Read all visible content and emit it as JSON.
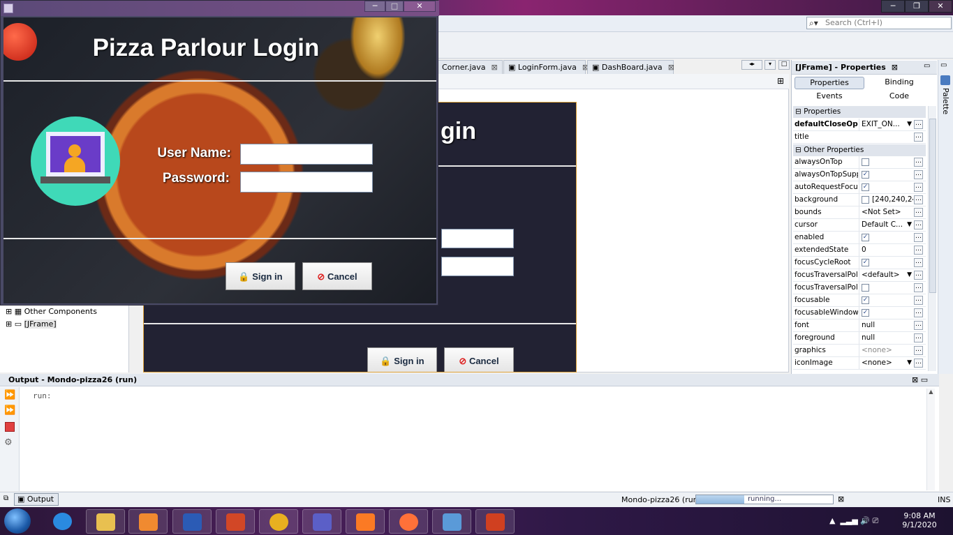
{
  "ide": {
    "search_placeholder": "Search (Ctrl+I)",
    "tabs": [
      {
        "label": "Corner.java"
      },
      {
        "label": "LoginForm.java"
      },
      {
        "label": "DashBoard.java"
      }
    ],
    "tree": [
      {
        "label": "Other Components"
      },
      {
        "label": "[JFrame]"
      }
    ]
  },
  "properties": {
    "title": "[JFrame] - Properties",
    "buttons": [
      "Properties",
      "Binding",
      "Events",
      "Code"
    ],
    "section_properties": "Properties",
    "section_other": "Other Properties",
    "rows": [
      {
        "name": "defaultCloseOpe",
        "value": "EXIT_ON...",
        "kind": "combo"
      },
      {
        "name": "title",
        "value": "",
        "kind": "text"
      }
    ],
    "other_rows": [
      {
        "name": "alwaysOnTop",
        "value": "",
        "kind": "check",
        "checked": false
      },
      {
        "name": "alwaysOnTopSupp",
        "value": "",
        "kind": "check",
        "checked": true
      },
      {
        "name": "autoRequestFocus",
        "value": "",
        "kind": "check",
        "checked": true
      },
      {
        "name": "background",
        "value": "[240,240,24",
        "kind": "color"
      },
      {
        "name": "bounds",
        "value": "<Not Set>",
        "kind": "text"
      },
      {
        "name": "cursor",
        "value": "Default C...",
        "kind": "combo"
      },
      {
        "name": "enabled",
        "value": "",
        "kind": "check",
        "checked": true
      },
      {
        "name": "extendedState",
        "value": "0",
        "kind": "text"
      },
      {
        "name": "focusCycleRoot",
        "value": "",
        "kind": "check",
        "checked": true
      },
      {
        "name": "focusTraversalPoli",
        "value": "<default>",
        "kind": "combo"
      },
      {
        "name": "focusTraversalPoli",
        "value": "",
        "kind": "check",
        "checked": false
      },
      {
        "name": "focusable",
        "value": "",
        "kind": "check",
        "checked": true
      },
      {
        "name": "focusableWindowS",
        "value": "",
        "kind": "check",
        "checked": true
      },
      {
        "name": "font",
        "value": "null",
        "kind": "text"
      },
      {
        "name": "foreground",
        "value": "null",
        "kind": "text"
      },
      {
        "name": "graphics",
        "value": "<none>",
        "kind": "text"
      },
      {
        "name": "iconImage",
        "value": "<none>",
        "kind": "combo"
      }
    ]
  },
  "palette": {
    "label": "Palette"
  },
  "output": {
    "title": "Output - Mondo-pizza26 (run)",
    "text": "run:",
    "tab_label": "Output"
  },
  "status": {
    "project": "Mondo-pizza26 (run)",
    "progress_text": "running...",
    "progress_fraction": 0.35,
    "ins": "INS"
  },
  "login_window": {
    "title": "Pizza Parlour Login",
    "username_label": "User Name:",
    "password_label": "Password:",
    "signin_label": "Sign in",
    "cancel_label": "Cancel",
    "username_value": "",
    "password_value": ""
  },
  "design_preview": {
    "title_fragment": "gin",
    "signin_label": "Sign in",
    "cancel_label": "Cancel"
  },
  "taskbar": {
    "time": "9:08 AM",
    "date": "9/1/2020",
    "apps": [
      "ie",
      "explorer",
      "media",
      "word",
      "powerpoint",
      "chrome",
      "teams",
      "xampp",
      "firefox",
      "virtualbox",
      "java"
    ]
  }
}
